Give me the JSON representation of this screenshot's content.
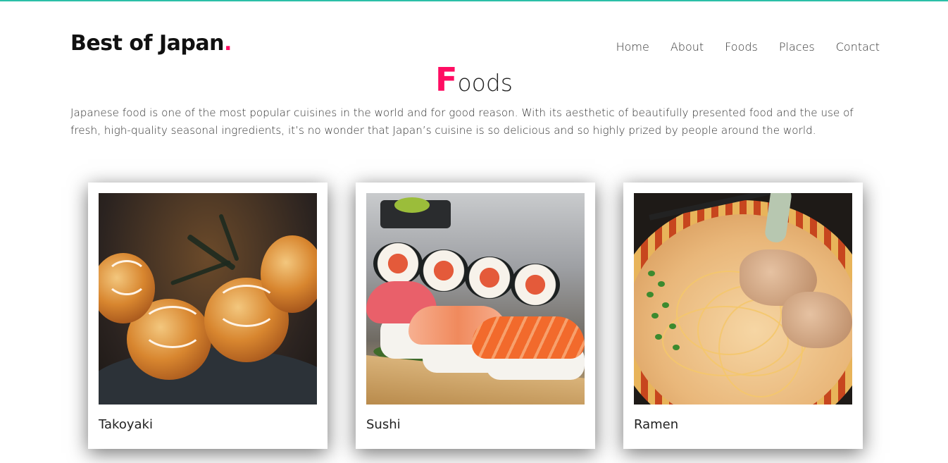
{
  "brand": {
    "name": "Best of Japan",
    "dot": "."
  },
  "nav": [
    "Home",
    "About",
    "Foods",
    "Places",
    "Contact"
  ],
  "section": {
    "title_first": "F",
    "title_rest": "oods",
    "description": "Japanese food is one of the most popular cuisines in the world and for good reason. With its aesthetic of beautifully presented food and the use of fresh, high-quality seasonal ingredients, it’s no wonder that Japan’s cuisine is so delicious and so highly prized by people around the world."
  },
  "cards": [
    {
      "title": "Takoyaki"
    },
    {
      "title": "Sushi"
    },
    {
      "title": "Ramen"
    }
  ],
  "colors": {
    "accent": "#ff0d62",
    "top_border": "#2bbfa8"
  }
}
